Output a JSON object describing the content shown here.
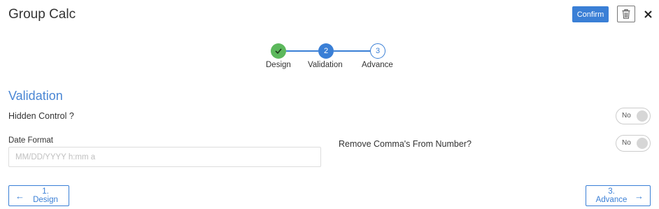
{
  "header": {
    "title": "Group Calc",
    "confirm_label": "Confirm"
  },
  "stepper": {
    "steps": [
      {
        "number": "1",
        "label": "Design",
        "state": "done"
      },
      {
        "number": "2",
        "label": "Validation",
        "state": "active"
      },
      {
        "number": "3",
        "label": "Advance",
        "state": "pending"
      }
    ]
  },
  "section": {
    "title": "Validation",
    "hidden_control": {
      "label": "Hidden Control ?",
      "toggle_value": "No"
    },
    "date_format": {
      "label": "Date Format",
      "value": "",
      "placeholder": "MM/DD/YYYY h:mm a"
    },
    "remove_comma": {
      "label": "Remove Comma's From Number?",
      "toggle_value": "No"
    }
  },
  "footer": {
    "prev_label": "1. Design",
    "next_label": "3. Advance"
  },
  "colors": {
    "accent": "#3a7fd6",
    "success": "#5cb85c",
    "section_title": "#4a86d4"
  },
  "icons": {
    "trash": "trash-icon",
    "close": "close-icon",
    "check": "check-icon",
    "arrow_left": "arrow-left-icon",
    "arrow_right": "arrow-right-icon"
  }
}
